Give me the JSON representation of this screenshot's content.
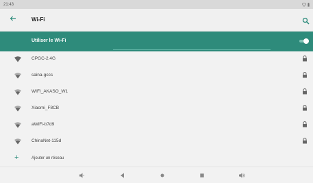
{
  "status_bar": {
    "time": "21:43",
    "icons": [
      "wifi-icon",
      "battery-icon"
    ]
  },
  "app_bar": {
    "title": "Wi-Fi",
    "back_icon": "back-arrow-icon",
    "search_icon": "search-icon"
  },
  "master_switch": {
    "label": "Utiliser le Wi-Fi",
    "on": true
  },
  "networks": [
    {
      "ssid": "CPGC-2.4G",
      "secured": true,
      "signal_icon": "wifi-signal-icon"
    },
    {
      "ssid": "saina-gccs",
      "secured": true,
      "signal_icon": "wifi-signal-icon"
    },
    {
      "ssid": "WIFI_AKASO_W1",
      "secured": true,
      "signal_icon": "wifi-signal-icon"
    },
    {
      "ssid": "Xiaomi_F8CB",
      "secured": true,
      "signal_icon": "wifi-signal-icon"
    },
    {
      "ssid": "aWiFi-b7d9",
      "secured": true,
      "signal_icon": "wifi-signal-icon"
    },
    {
      "ssid": "ChinaNet-115d",
      "secured": true,
      "signal_icon": "wifi-signal-icon"
    }
  ],
  "add_network": {
    "label": "Ajouter un réseau",
    "icon": "plus-icon"
  },
  "nav_bar": {
    "buttons": [
      "volume-down-icon",
      "back-icon",
      "home-icon",
      "recents-icon",
      "volume-up-icon"
    ]
  },
  "colors": {
    "accent": "#2e8b7b",
    "accent_text": "#2a8a7a",
    "background": "#f2f2f2",
    "status_bar": "#d9d9d9"
  }
}
